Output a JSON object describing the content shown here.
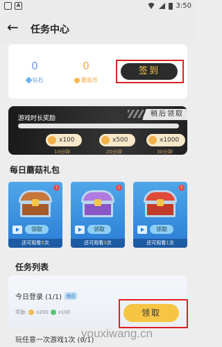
{
  "statusbar": {
    "time": "3:50",
    "left_icon_label": "A"
  },
  "nav": {
    "title": "任务中心"
  },
  "summary": {
    "diamond_value": "0",
    "diamond_label": "钻石",
    "coin_value": "0",
    "coin_label": "蘑菇币",
    "signin_label": "签到"
  },
  "playtime": {
    "title": "游戏时长奖励",
    "later_label": "稍后领取",
    "progress": 0,
    "rewards": [
      {
        "amount": "x100",
        "minutes": "10分钟"
      },
      {
        "amount": "x500",
        "minutes": "20分钟"
      },
      {
        "amount": "x1000",
        "minutes": "30分钟"
      }
    ]
  },
  "daily": {
    "title": "每日蘑菇礼包",
    "boxes": [
      {
        "badge": "!",
        "claim_label": "领取",
        "remain_prefix": "还可观看",
        "remain_count": "5",
        "remain_suffix": "次",
        "chest_color": "#c8763a"
      },
      {
        "badge": "!",
        "claim_label": "领取",
        "remain_prefix": "还可观看",
        "remain_count": "3",
        "remain_suffix": "次",
        "chest_color": "#b07ae0"
      },
      {
        "badge": "!",
        "claim_label": "领取",
        "remain_prefix": "还可观看",
        "remain_count": "1",
        "remain_suffix": "次",
        "chest_color": "#e04a3a"
      }
    ]
  },
  "tasks": {
    "title": "任务列表",
    "items": [
      {
        "name": "今日登录 (1/1)",
        "tag": "每日",
        "reward_label": "奖励:",
        "coin": "x200",
        "gem": "x100",
        "claim_label": "领取"
      },
      {
        "name": "玩任意一次游戏1次 (0/1)"
      }
    ]
  },
  "watermark": "youxiwang.cn"
}
